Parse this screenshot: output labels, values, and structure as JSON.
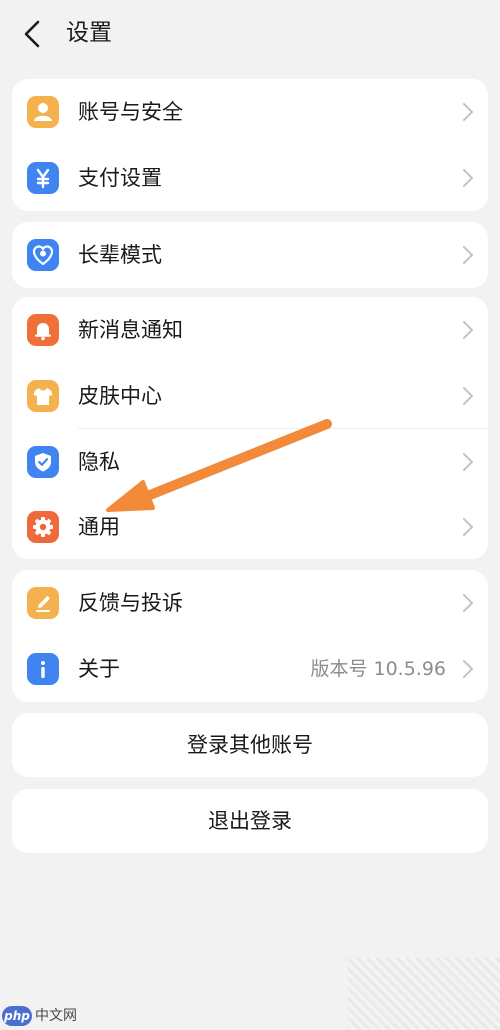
{
  "header": {
    "title": "设置"
  },
  "groups": [
    {
      "items": [
        {
          "label": "账号与安全",
          "icon": "account-user-icon",
          "color": "#f4b24e"
        },
        {
          "label": "支付设置",
          "icon": "yuan-payment-icon",
          "color": "#3f84f0"
        }
      ]
    },
    {
      "items": [
        {
          "label": "长辈模式",
          "icon": "elder-heart-icon",
          "color": "#3f84f0"
        }
      ]
    },
    {
      "items": [
        {
          "label": "新消息通知",
          "icon": "bell-icon",
          "color": "#f0703a"
        },
        {
          "label": "皮肤中心",
          "icon": "shirt-icon",
          "color": "#f4b24e"
        },
        {
          "label": "隐私",
          "icon": "shield-icon",
          "color": "#3f84f0"
        },
        {
          "label": "通用",
          "icon": "gear-icon",
          "color": "#ef6a3a"
        }
      ]
    },
    {
      "items": [
        {
          "label": "反馈与投诉",
          "icon": "edit-pencil-icon",
          "color": "#f4b24e"
        },
        {
          "label": "关于",
          "icon": "info-icon",
          "color": "#3f84f0",
          "value": "版本号 10.5.96"
        }
      ]
    }
  ],
  "buttons": {
    "switch_account": "登录其他账号",
    "logout": "退出登录"
  },
  "annotation": {
    "color": "#f28a3a"
  },
  "watermark": {
    "logo_text": "php",
    "site_text": "中文网"
  }
}
